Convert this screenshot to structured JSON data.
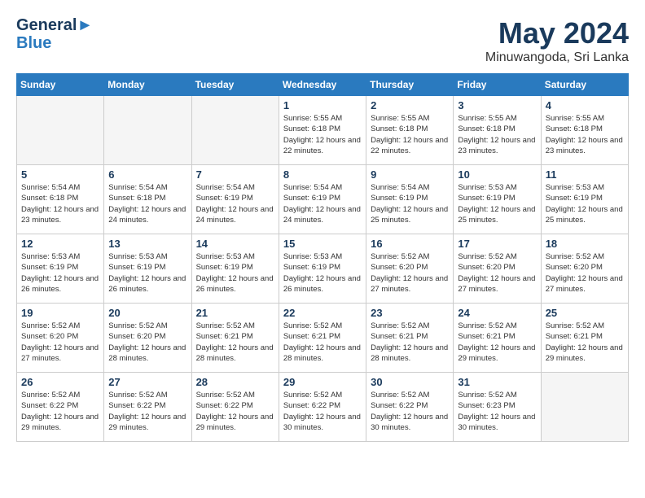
{
  "header": {
    "logo_line1": "General",
    "logo_line2": "Blue",
    "month_title": "May 2024",
    "location": "Minuwangoda, Sri Lanka"
  },
  "days_of_week": [
    "Sunday",
    "Monday",
    "Tuesday",
    "Wednesday",
    "Thursday",
    "Friday",
    "Saturday"
  ],
  "weeks": [
    [
      {
        "day": "",
        "empty": true
      },
      {
        "day": "",
        "empty": true
      },
      {
        "day": "",
        "empty": true
      },
      {
        "day": "1",
        "sunrise": "5:55 AM",
        "sunset": "6:18 PM",
        "daylight": "12 hours and 22 minutes."
      },
      {
        "day": "2",
        "sunrise": "5:55 AM",
        "sunset": "6:18 PM",
        "daylight": "12 hours and 22 minutes."
      },
      {
        "day": "3",
        "sunrise": "5:55 AM",
        "sunset": "6:18 PM",
        "daylight": "12 hours and 23 minutes."
      },
      {
        "day": "4",
        "sunrise": "5:55 AM",
        "sunset": "6:18 PM",
        "daylight": "12 hours and 23 minutes."
      }
    ],
    [
      {
        "day": "5",
        "sunrise": "5:54 AM",
        "sunset": "6:18 PM",
        "daylight": "12 hours and 23 minutes."
      },
      {
        "day": "6",
        "sunrise": "5:54 AM",
        "sunset": "6:18 PM",
        "daylight": "12 hours and 24 minutes."
      },
      {
        "day": "7",
        "sunrise": "5:54 AM",
        "sunset": "6:19 PM",
        "daylight": "12 hours and 24 minutes."
      },
      {
        "day": "8",
        "sunrise": "5:54 AM",
        "sunset": "6:19 PM",
        "daylight": "12 hours and 24 minutes."
      },
      {
        "day": "9",
        "sunrise": "5:54 AM",
        "sunset": "6:19 PM",
        "daylight": "12 hours and 25 minutes."
      },
      {
        "day": "10",
        "sunrise": "5:53 AM",
        "sunset": "6:19 PM",
        "daylight": "12 hours and 25 minutes."
      },
      {
        "day": "11",
        "sunrise": "5:53 AM",
        "sunset": "6:19 PM",
        "daylight": "12 hours and 25 minutes."
      }
    ],
    [
      {
        "day": "12",
        "sunrise": "5:53 AM",
        "sunset": "6:19 PM",
        "daylight": "12 hours and 26 minutes."
      },
      {
        "day": "13",
        "sunrise": "5:53 AM",
        "sunset": "6:19 PM",
        "daylight": "12 hours and 26 minutes."
      },
      {
        "day": "14",
        "sunrise": "5:53 AM",
        "sunset": "6:19 PM",
        "daylight": "12 hours and 26 minutes."
      },
      {
        "day": "15",
        "sunrise": "5:53 AM",
        "sunset": "6:19 PM",
        "daylight": "12 hours and 26 minutes."
      },
      {
        "day": "16",
        "sunrise": "5:52 AM",
        "sunset": "6:20 PM",
        "daylight": "12 hours and 27 minutes."
      },
      {
        "day": "17",
        "sunrise": "5:52 AM",
        "sunset": "6:20 PM",
        "daylight": "12 hours and 27 minutes."
      },
      {
        "day": "18",
        "sunrise": "5:52 AM",
        "sunset": "6:20 PM",
        "daylight": "12 hours and 27 minutes."
      }
    ],
    [
      {
        "day": "19",
        "sunrise": "5:52 AM",
        "sunset": "6:20 PM",
        "daylight": "12 hours and 27 minutes."
      },
      {
        "day": "20",
        "sunrise": "5:52 AM",
        "sunset": "6:20 PM",
        "daylight": "12 hours and 28 minutes."
      },
      {
        "day": "21",
        "sunrise": "5:52 AM",
        "sunset": "6:21 PM",
        "daylight": "12 hours and 28 minutes."
      },
      {
        "day": "22",
        "sunrise": "5:52 AM",
        "sunset": "6:21 PM",
        "daylight": "12 hours and 28 minutes."
      },
      {
        "day": "23",
        "sunrise": "5:52 AM",
        "sunset": "6:21 PM",
        "daylight": "12 hours and 28 minutes."
      },
      {
        "day": "24",
        "sunrise": "5:52 AM",
        "sunset": "6:21 PM",
        "daylight": "12 hours and 29 minutes."
      },
      {
        "day": "25",
        "sunrise": "5:52 AM",
        "sunset": "6:21 PM",
        "daylight": "12 hours and 29 minutes."
      }
    ],
    [
      {
        "day": "26",
        "sunrise": "5:52 AM",
        "sunset": "6:22 PM",
        "daylight": "12 hours and 29 minutes."
      },
      {
        "day": "27",
        "sunrise": "5:52 AM",
        "sunset": "6:22 PM",
        "daylight": "12 hours and 29 minutes."
      },
      {
        "day": "28",
        "sunrise": "5:52 AM",
        "sunset": "6:22 PM",
        "daylight": "12 hours and 29 minutes."
      },
      {
        "day": "29",
        "sunrise": "5:52 AM",
        "sunset": "6:22 PM",
        "daylight": "12 hours and 30 minutes."
      },
      {
        "day": "30",
        "sunrise": "5:52 AM",
        "sunset": "6:22 PM",
        "daylight": "12 hours and 30 minutes."
      },
      {
        "day": "31",
        "sunrise": "5:52 AM",
        "sunset": "6:23 PM",
        "daylight": "12 hours and 30 minutes."
      },
      {
        "day": "",
        "empty": true
      }
    ]
  ]
}
